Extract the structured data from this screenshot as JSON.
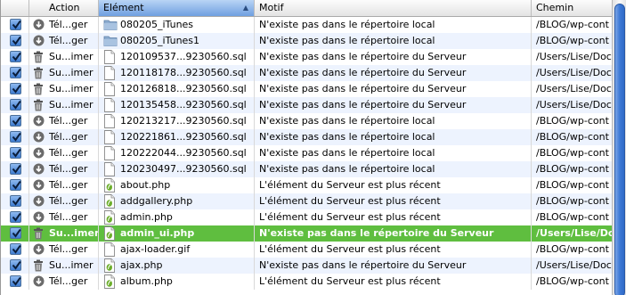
{
  "header": {
    "action_label": "Action",
    "element_label": "Elément",
    "motif_label": "Motif",
    "chemin_label": "Chemin",
    "sorted_column": "Elément",
    "sort_icon": "sort-ascending-icon"
  },
  "colors": {
    "selected_row": "#5fbe3f",
    "alt_row": "#edf3fe",
    "checkbox": "#3d7bd0",
    "scroll_thumb": "#3d79d6"
  },
  "rows": [
    {
      "checked": true,
      "action_icon": "download-icon",
      "action": "Tél...ger",
      "element_icon": "folder-icon",
      "element": "080205_iTunes",
      "motif": "N'existe pas dans le répertoire local",
      "path": "/BLOG/wp-cont"
    },
    {
      "checked": true,
      "action_icon": "download-icon",
      "action": "Tél...ger",
      "element_icon": "folder-icon",
      "element": "080205_iTunes1",
      "motif": "N'existe pas dans le répertoire local",
      "path": "/BLOG/wp-cont"
    },
    {
      "checked": true,
      "action_icon": "trash-icon",
      "action": "Su...imer",
      "element_icon": "document-icon",
      "element": "120109537...9230560.sql",
      "motif": "N'existe pas dans le répertoire du Serveur",
      "path": "/Users/Lise/Doc"
    },
    {
      "checked": true,
      "action_icon": "trash-icon",
      "action": "Su...imer",
      "element_icon": "document-icon",
      "element": "120118178...9230560.sql",
      "motif": "N'existe pas dans le répertoire du Serveur",
      "path": "/Users/Lise/Doc"
    },
    {
      "checked": true,
      "action_icon": "trash-icon",
      "action": "Su...imer",
      "element_icon": "document-icon",
      "element": "120126818...9230560.sql",
      "motif": "N'existe pas dans le répertoire du Serveur",
      "path": "/Users/Lise/Doc"
    },
    {
      "checked": true,
      "action_icon": "trash-icon",
      "action": "Su...imer",
      "element_icon": "document-icon",
      "element": "120135458...9230560.sql",
      "motif": "N'existe pas dans le répertoire du Serveur",
      "path": "/Users/Lise/Doc"
    },
    {
      "checked": true,
      "action_icon": "download-icon",
      "action": "Tél...ger",
      "element_icon": "document-icon",
      "element": "120213217...9230560.sql",
      "motif": "N'existe pas dans le répertoire local",
      "path": "/BLOG/wp-cont"
    },
    {
      "checked": true,
      "action_icon": "download-icon",
      "action": "Tél...ger",
      "element_icon": "document-icon",
      "element": "120221861...9230560.sql",
      "motif": "N'existe pas dans le répertoire local",
      "path": "/BLOG/wp-cont"
    },
    {
      "checked": true,
      "action_icon": "download-icon",
      "action": "Tél...ger",
      "element_icon": "document-icon",
      "element": "120222044...9230560.sql",
      "motif": "N'existe pas dans le répertoire local",
      "path": "/BLOG/wp-cont"
    },
    {
      "checked": true,
      "action_icon": "download-icon",
      "action": "Tél...ger",
      "element_icon": "document-icon",
      "element": "120230497...9230560.sql",
      "motif": "N'existe pas dans le répertoire local",
      "path": "/BLOG/wp-cont"
    },
    {
      "checked": true,
      "action_icon": "download-icon",
      "action": "Tél...ger",
      "element_icon": "php-file-icon",
      "element": "about.php",
      "motif": "L'élément du Serveur est plus récent",
      "path": "/BLOG/wp-cont"
    },
    {
      "checked": true,
      "action_icon": "download-icon",
      "action": "Tél...ger",
      "element_icon": "php-file-icon",
      "element": "addgallery.php",
      "motif": "L'élément du Serveur est plus récent",
      "path": "/BLOG/wp-cont"
    },
    {
      "checked": true,
      "action_icon": "download-icon",
      "action": "Tél...ger",
      "element_icon": "php-file-icon",
      "element": "admin.php",
      "motif": "L'élément du Serveur est plus récent",
      "path": "/BLOG/wp-cont"
    },
    {
      "checked": true,
      "action_icon": "trash-icon",
      "action": "Su...imer",
      "element_icon": "php-file-icon",
      "element": "admin_ui.php",
      "motif": "N'existe pas dans le répertoire du Serveur",
      "path": "/Users/Lise/Doc",
      "selected": true
    },
    {
      "checked": true,
      "action_icon": "download-icon",
      "action": "Tél...ger",
      "element_icon": "document-icon",
      "element": "ajax-loader.gif",
      "motif": "L'élément du Serveur est plus récent",
      "path": "/BLOG/wp-cont"
    },
    {
      "checked": true,
      "action_icon": "trash-icon",
      "action": "Su...imer",
      "element_icon": "php-file-icon",
      "element": "ajax.php",
      "motif": "N'existe pas dans le répertoire du Serveur",
      "path": "/Users/Lise/Doc"
    },
    {
      "checked": true,
      "action_icon": "download-icon",
      "action": "Tél...ger",
      "element_icon": "php-file-icon",
      "element": "album.php",
      "motif": "L'élément du Serveur est plus récent",
      "path": "/BLOG/wp-cont"
    }
  ]
}
